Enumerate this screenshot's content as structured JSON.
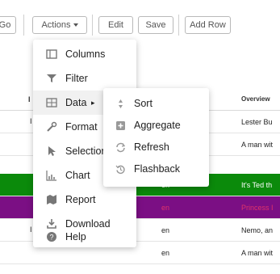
{
  "toolbar": {
    "go_label": "Go",
    "actions_label": "Actions",
    "edit_label": "Edit",
    "save_label": "Save",
    "add_row_label": "Add Row"
  },
  "grid": {
    "header": {
      "overview": "Overview"
    },
    "rows": [
      {
        "lang": "",
        "overview": "Lester Bu",
        "left": "I"
      },
      {
        "lang": "",
        "overview": "A man wit",
        "left": ""
      },
      {
        "lang": "en",
        "overview": "It's Ted th",
        "left": ""
      },
      {
        "lang": "en",
        "overview": "Princess I",
        "left": ""
      },
      {
        "lang": "en",
        "overview": "Nemo, an",
        "left": "I"
      },
      {
        "lang": "en",
        "overview": "A man wit",
        "left": ""
      }
    ]
  },
  "actions_menu": {
    "items": [
      {
        "label": "Columns",
        "icon": "columns-icon"
      },
      {
        "label": "Filter",
        "icon": "filter-icon"
      },
      {
        "label": "Data",
        "icon": "data-grid-icon"
      },
      {
        "label": "Format",
        "icon": "wrench-icon"
      },
      {
        "label": "Selection",
        "icon": "cursor-icon"
      },
      {
        "label": "Chart",
        "icon": "chart-icon"
      },
      {
        "label": "Report",
        "icon": "report-icon"
      },
      {
        "label": "Download",
        "icon": "download-icon"
      },
      {
        "label": "Help",
        "icon": "help-icon"
      }
    ]
  },
  "data_submenu": {
    "items": [
      {
        "label": "Sort",
        "icon": "sort-icon"
      },
      {
        "label": "Aggregate",
        "icon": "aggregate-icon"
      },
      {
        "label": "Refresh",
        "icon": "refresh-icon"
      },
      {
        "label": "Flashback",
        "icon": "flashback-icon"
      }
    ]
  },
  "colors": {
    "green_row": "#0b8a0b",
    "purple_row": "#7b0f84",
    "purple_text": "#e0336a"
  }
}
